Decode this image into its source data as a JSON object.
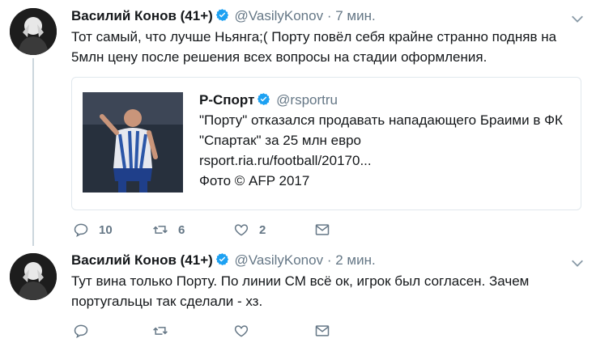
{
  "tweets": [
    {
      "name": "Василий Конов (41+)",
      "handle": "@VasilyKonov",
      "separator": "·",
      "time": "7 мин.",
      "text": "Тот самый, что лучше Ньянга;( Порту повёл себя крайне странно подняв на 5млн цену после решения всех вопросы на стадии оформления.",
      "card": {
        "name": "Р-Спорт",
        "handle": "@rsportru",
        "headline": "\"Порту\" отказался продавать нападающего Браими в ФК \"Спартак\" за 25 млн евро",
        "link": "rsport.ria.ru/football/20170...",
        "photo_credit": "Фото © AFP 2017"
      },
      "actions": {
        "replies": "10",
        "retweets": "6",
        "likes": "2"
      },
      "icons": {
        "reply": "reply-icon",
        "retweet": "retweet-icon",
        "like": "heart-icon",
        "dm": "envelope-icon",
        "more": "chevron-down-icon",
        "verified": "verified-badge-icon"
      }
    },
    {
      "name": "Василий Конов (41+)",
      "handle": "@VasilyKonov",
      "separator": "·",
      "time": "2 мин.",
      "text": "Тут вина только Порту. По линии СМ всё ок, игрок был согласен. Зачем португальцы так сделали - хз.",
      "actions": {
        "replies": "",
        "retweets": "",
        "likes": ""
      }
    }
  ],
  "colors": {
    "verified": "#1da1f2",
    "text": "#14171a",
    "muted": "#657786",
    "thread_line": "#ccd6dd",
    "card_border": "#e1e8ed"
  }
}
